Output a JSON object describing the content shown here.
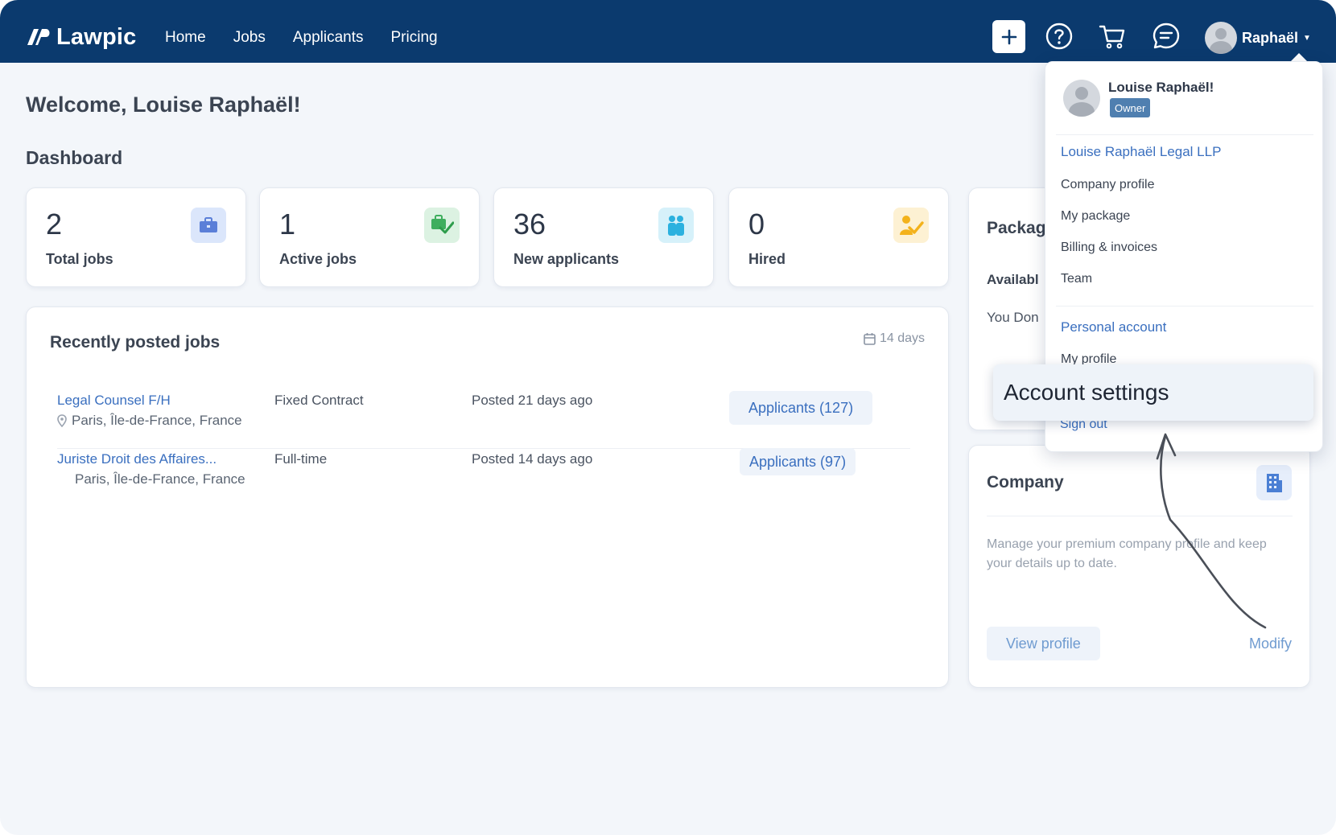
{
  "navbar": {
    "brand": "Lawpic",
    "links": [
      "Home",
      "Jobs",
      "Applicants",
      "Pricing"
    ],
    "icons": [
      "plus-icon",
      "help-icon",
      "cart-icon",
      "chat-icon"
    ],
    "user_name": "Raphaël",
    "bg_color": "#0b3a6e"
  },
  "main": {
    "welcome": "Welcome, Louise Raphaël!",
    "dashboard_title": "Dashboard",
    "stats": [
      {
        "value": "2",
        "label": "Total jobs",
        "icon": "briefcase-icon"
      },
      {
        "value": "1",
        "label": "Active jobs",
        "icon": "briefcase-check-icon"
      },
      {
        "value": "36",
        "label": "New applicants",
        "icon": "people-icon"
      },
      {
        "value": "0",
        "label": "Hired",
        "icon": "person-check-icon"
      }
    ],
    "jobs_panel": {
      "title": "Recently posted jobs",
      "range": "14 days",
      "jobs": [
        {
          "title": "Legal Counsel F/H",
          "location": "Paris, Île-de-France, France",
          "type": "Fixed Contract",
          "posted": "Posted 21 days ago",
          "applicants": "Applicants  (127)"
        },
        {
          "title": "Juriste Droit des Affaires...",
          "location": "Paris, Île-de-France, France",
          "type": "Full-time",
          "posted": "Posted 14 days ago",
          "applicants": "Applicants  (97)"
        }
      ]
    },
    "package_panel": {
      "title": "Packag",
      "available": "Availabl",
      "note": "You Don"
    },
    "company_panel": {
      "title": "Company",
      "description": "Manage your premium company profile and keep your details up to date.",
      "view_profile": "View profile",
      "modify": "Modify"
    }
  },
  "dropdown": {
    "name": "Louise Raphaël!",
    "role": "Owner",
    "company_section": "Louise Raphaël Legal LLP",
    "company_items": [
      "Company profile",
      "My package",
      "Billing & invoices",
      "Team"
    ],
    "personal_section": "Personal account",
    "my_profile": "My profile",
    "highlight": "Account settings",
    "sign_out": "Sign out"
  }
}
